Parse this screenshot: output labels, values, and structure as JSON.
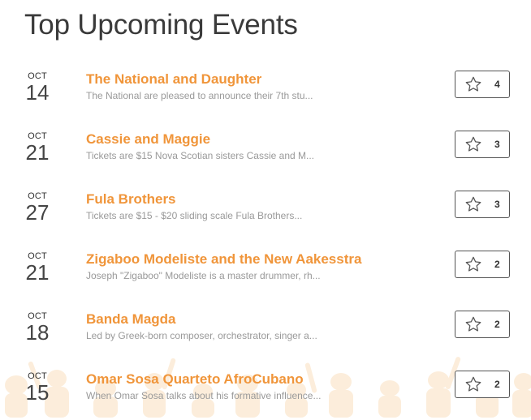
{
  "page": {
    "title": "Top Upcoming Events"
  },
  "events": [
    {
      "month": "OCT",
      "day": "14",
      "title": "The National and Daughter",
      "description": "The National are pleased to announce their 7th stu...",
      "favorites": "4",
      "favorite_icon": "star-outline-icon"
    },
    {
      "month": "OCT",
      "day": "21",
      "title": "Cassie and Maggie",
      "description": "Tickets are $15 Nova Scotian sisters Cassie and M...",
      "favorites": "3",
      "favorite_icon": "star-outline-icon"
    },
    {
      "month": "OCT",
      "day": "27",
      "title": "Fula Brothers",
      "description": "Tickets are $15 - $20 sliding scale Fula Brothers...",
      "favorites": "3",
      "favorite_icon": "star-outline-icon"
    },
    {
      "month": "OCT",
      "day": "21",
      "title": "Zigaboo Modeliste and the New Aakesstra",
      "description": "Joseph \"Zigaboo\" Modeliste is a master drummer, rh...",
      "favorites": "2",
      "favorite_icon": "star-outline-icon"
    },
    {
      "month": "OCT",
      "day": "18",
      "title": "Banda Magda",
      "description": "Led by Greek-born composer, orchestrator, singer a...",
      "favorites": "2",
      "favorite_icon": "star-outline-icon"
    },
    {
      "month": "OCT",
      "day": "15",
      "title": "Omar Sosa Quarteto AfroCubano",
      "description": "When Omar Sosa talks about his formative influence...",
      "favorites": "2",
      "favorite_icon": "star-outline-icon"
    }
  ],
  "colors": {
    "event_title": "#f0953a",
    "description": "#999999",
    "heading": "#3a3a3a",
    "button_border": "#555555",
    "decor": "#fbe8cf"
  }
}
